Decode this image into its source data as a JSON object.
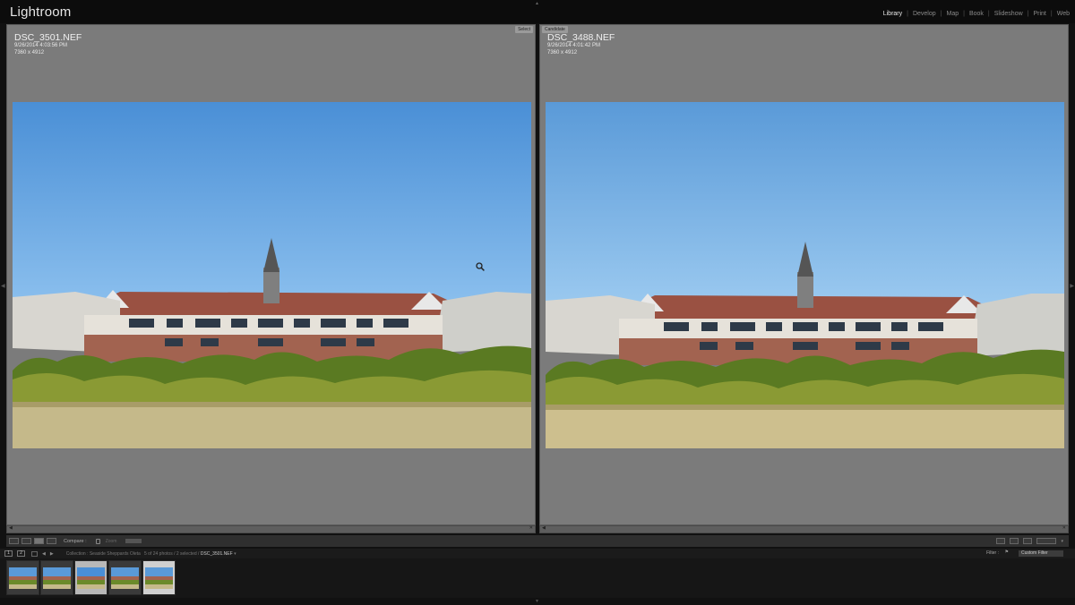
{
  "app": {
    "title": "Lightroom"
  },
  "modules": [
    {
      "label": "Library",
      "active": true
    },
    {
      "label": "Develop",
      "active": false
    },
    {
      "label": "Map",
      "active": false
    },
    {
      "label": "Book",
      "active": false
    },
    {
      "label": "Slideshow",
      "active": false
    },
    {
      "label": "Print",
      "active": false
    },
    {
      "label": "Web",
      "active": false
    }
  ],
  "left_pane": {
    "tag": "Select",
    "filename": "DSC_3501.NEF",
    "datetime": "9/26/2014 4:03:56 PM",
    "dimensions": "7360 x 4912"
  },
  "right_pane": {
    "tag": "Candidate",
    "filename": "DSC_3488.NEF",
    "datetime": "9/26/2014 4:01:42 PM",
    "dimensions": "7360 x 4912"
  },
  "toolbar": {
    "compare_label": "Compare :",
    "zoom_label": "Zoom"
  },
  "filmstrip": {
    "collection": "Collection : Seaside Sheppards Oleta",
    "count": "5 of 24 photos / 2 selected /",
    "current_file": "DSC_3501.NEF",
    "filter_label": "Filter :",
    "filter_value": "Custom Filter"
  },
  "icons": {
    "zoom": "zoom-cursor-icon",
    "lock": "lock-icon"
  },
  "colors": {
    "background": "#111111",
    "pane": "#7b7b7b",
    "active_module": "#e8e8e8",
    "sky_top": "#4a8fd6",
    "sky_bottom": "#8cc0ee"
  }
}
